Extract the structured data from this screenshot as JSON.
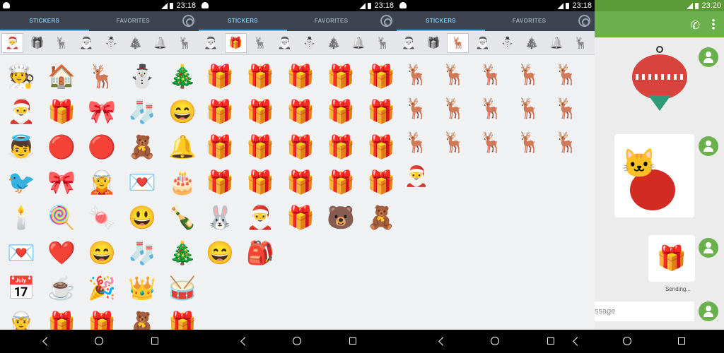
{
  "screens": [
    {
      "time": "23:18",
      "tabs": {
        "stickers": "STICKERS",
        "favorites": "FAVORITES"
      },
      "categories": [
        "🎅",
        "🎁",
        "🦌",
        "🎅",
        "⛄",
        "🎄",
        "🔔",
        "🦌"
      ],
      "active_category": 0,
      "stickers": [
        "🧑‍🍳",
        "🏠",
        "🦌",
        "⛄",
        "🎄",
        "🎅",
        "🎁",
        "🎀",
        "🧦",
        "😄",
        "👼",
        "🔴",
        "🔴",
        "🧸",
        "🔔",
        "🐦",
        "🎀",
        "🧝",
        "💌",
        "🎂",
        "🕯️",
        "🍭",
        "🍬",
        "😃",
        "🍾",
        "💌",
        "❤️",
        "😄",
        "🧦",
        "🎄",
        "📅",
        "☕",
        "🎉",
        "👑",
        "🥁",
        "🧝",
        "🎁",
        "🎁",
        "🧸",
        "🎁"
      ]
    },
    {
      "time": "23:18",
      "tabs": {
        "stickers": "STICKERS",
        "favorites": "FAVORITES"
      },
      "categories": [
        "🎅",
        "🎁",
        "🦌",
        "🎅",
        "⛄",
        "🎄",
        "🔔",
        "🦌"
      ],
      "active_category": 1,
      "stickers": [
        "🎁",
        "🎁",
        "🎁",
        "🎁",
        "🎁",
        "🎁",
        "🎁",
        "🎁",
        "🎁",
        "🎁",
        "🎁",
        "🎁",
        "🎁",
        "🎁",
        "🎁",
        "🎁",
        "🎁",
        "🎁",
        "🎁",
        "🎁",
        "🐰",
        "🎅",
        "🎁",
        "🐻",
        "🧸",
        "😄",
        "🎒"
      ]
    },
    {
      "time": "23:18",
      "tabs": {
        "stickers": "STICKERS",
        "favorites": "FAVORITES"
      },
      "categories": [
        "🎅",
        "🎁",
        "🦌",
        "🎅",
        "⛄",
        "🎄",
        "🔔",
        "🦌"
      ],
      "active_category": 2,
      "stickers": [
        "🦌",
        "🦌",
        "🦌",
        "🦌",
        "🦌",
        "🦌",
        "🦌",
        "🦌",
        "🦌",
        "🦌",
        "🦌",
        "🦌",
        "🦌",
        "🦌",
        "🦌",
        "🎅"
      ]
    }
  ],
  "chat": {
    "time": "23:20",
    "sending_label": "Sending...",
    "input_placeholder": "ssage"
  },
  "colors": {
    "tab_bg": "#3d4450",
    "tab_active": "#7ec6f0",
    "chat_bar": "#6ab04c"
  }
}
